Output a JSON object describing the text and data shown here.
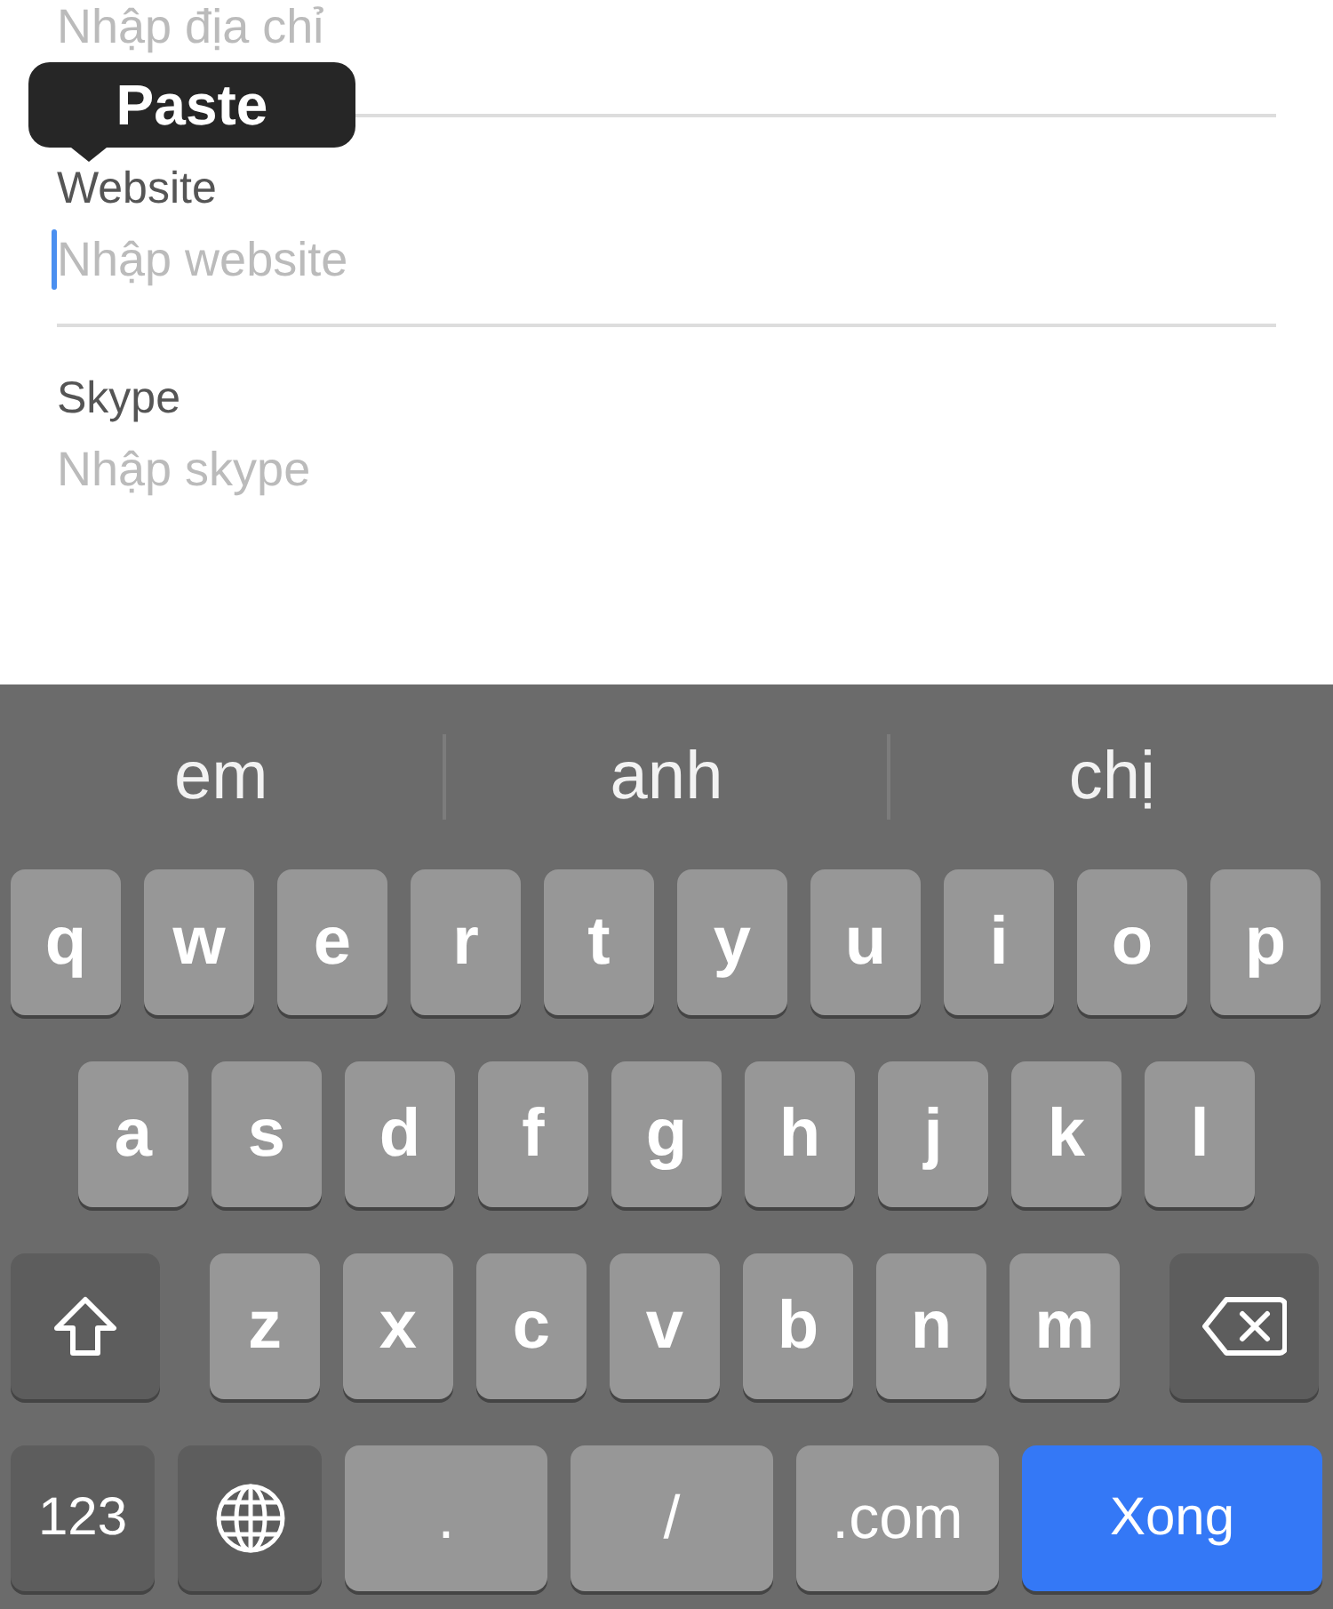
{
  "form": {
    "fields": [
      {
        "placeholder": "Nhập địa chỉ",
        "focused": false
      },
      {
        "label": "Website",
        "placeholder": "Nhập website",
        "focused": true
      },
      {
        "label": "Skype",
        "placeholder": "Nhập skype",
        "focused": false
      }
    ]
  },
  "popup": {
    "label": "Paste"
  },
  "keyboard": {
    "suggestions": [
      "em",
      "anh",
      "chị"
    ],
    "key_rows": [
      {
        "keys": [
          {
            "kind": "letter",
            "label": "q"
          },
          {
            "kind": "letter",
            "label": "w"
          },
          {
            "kind": "letter",
            "label": "e"
          },
          {
            "kind": "letter",
            "label": "r"
          },
          {
            "kind": "letter",
            "label": "t"
          },
          {
            "kind": "letter",
            "label": "y"
          },
          {
            "kind": "letter",
            "label": "u"
          },
          {
            "kind": "letter",
            "label": "i"
          },
          {
            "kind": "letter",
            "label": "o"
          },
          {
            "kind": "letter",
            "label": "p"
          }
        ]
      },
      {
        "keys": [
          {
            "kind": "letter",
            "label": "a"
          },
          {
            "kind": "letter",
            "label": "s"
          },
          {
            "kind": "letter",
            "label": "d"
          },
          {
            "kind": "letter",
            "label": "f"
          },
          {
            "kind": "letter",
            "label": "g"
          },
          {
            "kind": "letter",
            "label": "h"
          },
          {
            "kind": "letter",
            "label": "j"
          },
          {
            "kind": "letter",
            "label": "k"
          },
          {
            "kind": "letter",
            "label": "l"
          }
        ]
      },
      {
        "keys": [
          {
            "kind": "shift"
          },
          {
            "kind": "letter",
            "label": "z"
          },
          {
            "kind": "letter",
            "label": "x"
          },
          {
            "kind": "letter",
            "label": "c"
          },
          {
            "kind": "letter",
            "label": "v"
          },
          {
            "kind": "letter",
            "label": "b"
          },
          {
            "kind": "letter",
            "label": "n"
          },
          {
            "kind": "letter",
            "label": "m"
          },
          {
            "kind": "backspace"
          }
        ]
      },
      {
        "keys": [
          {
            "kind": "numbers",
            "label": "123"
          },
          {
            "kind": "globe"
          },
          {
            "kind": "wide",
            "label": "."
          },
          {
            "kind": "wide",
            "label": "/"
          },
          {
            "kind": "wide",
            "label": ".com"
          },
          {
            "kind": "done",
            "label": "Xong"
          }
        ]
      }
    ]
  }
}
